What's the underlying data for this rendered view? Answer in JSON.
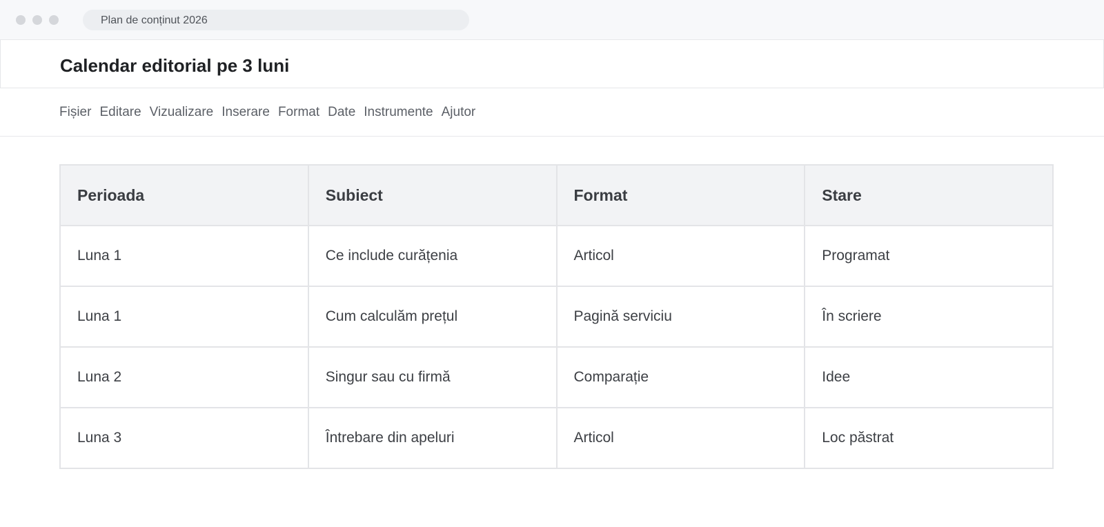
{
  "browser": {
    "address": "Plan de conținut 2026"
  },
  "header": {
    "title": "Calendar editorial pe 3 luni"
  },
  "menu": {
    "items": [
      "Fișier",
      "Editare",
      "Vizualizare",
      "Inserare",
      "Format",
      "Date",
      "Instrumente",
      "Ajutor"
    ]
  },
  "table": {
    "headers": [
      "Perioada",
      "Subiect",
      "Format",
      "Stare"
    ],
    "rows": [
      [
        "Luna 1",
        "Ce include curățenia",
        "Articol",
        "Programat"
      ],
      [
        "Luna 1",
        "Cum calculăm prețul",
        "Pagină serviciu",
        "În scriere"
      ],
      [
        "Luna 2",
        "Singur sau cu firmă",
        "Comparație",
        "Idee"
      ],
      [
        "Luna 3",
        "Întrebare din apeluri",
        "Articol",
        "Loc păstrat"
      ]
    ]
  }
}
